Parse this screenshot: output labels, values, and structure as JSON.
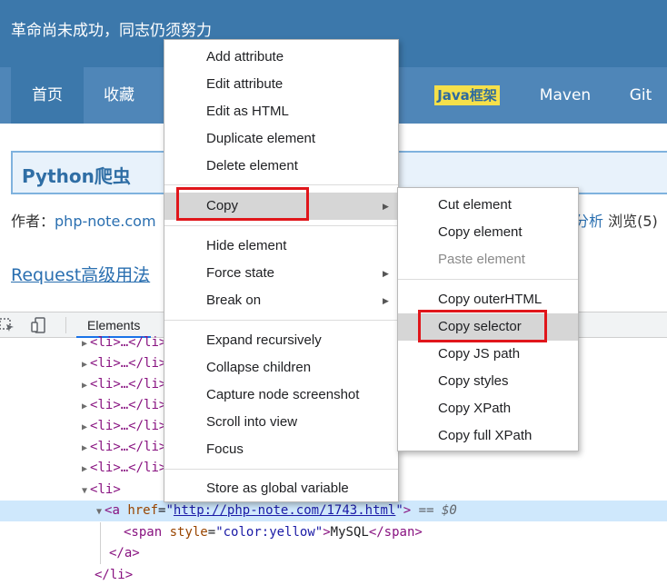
{
  "banner": {
    "text": "革命尚未成功，同志仍须努力"
  },
  "nav": {
    "items": [
      {
        "label": "首页"
      },
      {
        "label": "收藏"
      },
      {
        "label": "Java框架"
      },
      {
        "label": "Maven"
      },
      {
        "label": "Git"
      }
    ]
  },
  "post": {
    "title": "Python爬虫",
    "author_label": "作者：",
    "author": "php-note.com",
    "tag_fragment": "分析",
    "views": "浏览(5)",
    "section_link": "Request高级用法"
  },
  "devtools": {
    "tab_elements": "Elements",
    "dom": {
      "li_collapsed": "<li>…</li>",
      "li_open": "<li>",
      "a_tag_open": "<a",
      "a_href_attr": "href",
      "a_href_value": "http://php-note.com/1743.html",
      "a_close_bracket": ">",
      "eq_marker": "== $0",
      "span_open": "<span",
      "span_style_attr": "style",
      "span_style_value": "color:yellow",
      "span_text": "MySQL",
      "span_close": "</span>",
      "a_close": "</a>",
      "li_close": "</li>"
    }
  },
  "context_menu": {
    "items": [
      "Add attribute",
      "Edit attribute",
      "Edit as HTML",
      "Duplicate element",
      "Delete element",
      "Copy",
      "Hide element",
      "Force state",
      "Break on",
      "Expand recursively",
      "Collapse children",
      "Capture node screenshot",
      "Scroll into view",
      "Focus",
      "Store as global variable"
    ]
  },
  "copy_submenu": {
    "items": [
      "Cut element",
      "Copy element",
      "Paste element",
      "Copy outerHTML",
      "Copy selector",
      "Copy JS path",
      "Copy styles",
      "Copy XPath",
      "Copy full XPath"
    ]
  },
  "colors": {
    "banner": "#3c78ab",
    "nav": "#4f86b8",
    "highlight_box": "#e0161b"
  }
}
